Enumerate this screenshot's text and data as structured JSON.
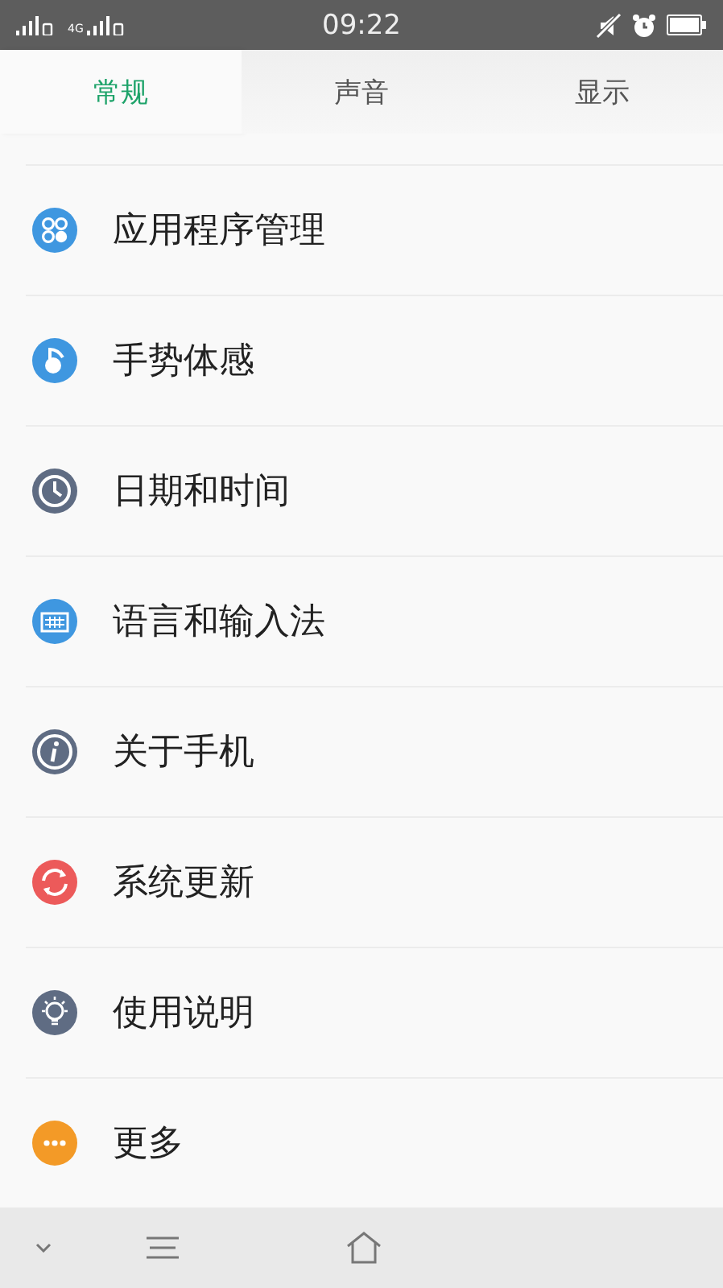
{
  "status_bar": {
    "network": "4G",
    "time": "09:22"
  },
  "tabs": [
    {
      "label": "常规",
      "selected": true
    },
    {
      "label": "声音",
      "selected": false
    },
    {
      "label": "显示",
      "selected": false
    }
  ],
  "items": [
    {
      "label": "应用程序管理",
      "kind": "apps",
      "color": "#3f97e0"
    },
    {
      "label": "手势体感",
      "kind": "gesture",
      "color": "#3f97e0"
    },
    {
      "label": "日期和时间",
      "kind": "clock",
      "color": "#5f6c83"
    },
    {
      "label": "语言和输入法",
      "kind": "keyboard",
      "color": "#3f97e0"
    },
    {
      "label": "关于手机",
      "kind": "info",
      "color": "#5f6c83"
    },
    {
      "label": "系统更新",
      "kind": "update",
      "color": "#ec5a5a"
    },
    {
      "label": "使用说明",
      "kind": "bulb",
      "color": "#5f6c83"
    },
    {
      "label": "更多",
      "kind": "more",
      "color": "#f39a27"
    }
  ]
}
